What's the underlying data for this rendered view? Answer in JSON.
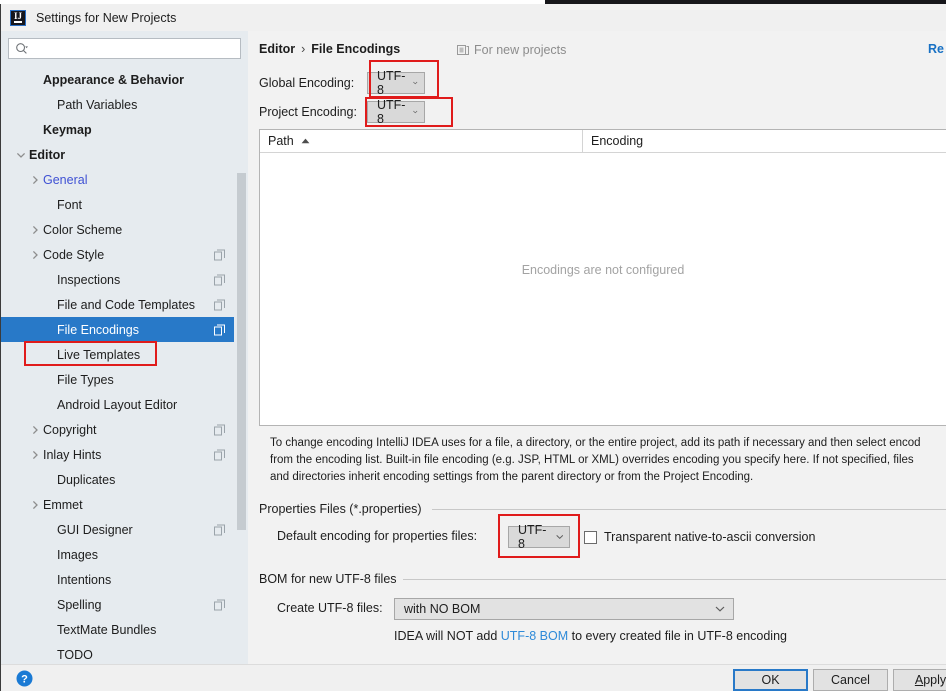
{
  "window": {
    "title": "Settings for New Projects",
    "logo_icon": "intellij-idea-logo"
  },
  "sidebar": {
    "search": {
      "placeholder": "",
      "value": "",
      "icon": "search-icon"
    },
    "items": [
      {
        "label": "Appearance & Behavior",
        "level": 1,
        "category": true,
        "arrow": "none",
        "copy": false,
        "selected": false,
        "link": false
      },
      {
        "label": "Path Variables",
        "level": 2,
        "category": false,
        "arrow": "none",
        "copy": false,
        "selected": false,
        "link": false
      },
      {
        "label": "Keymap",
        "level": 1,
        "category": true,
        "arrow": "none",
        "copy": false,
        "selected": false,
        "link": false
      },
      {
        "label": "Editor",
        "level": 1,
        "category": true,
        "arrow": "down",
        "copy": false,
        "selected": false,
        "link": false
      },
      {
        "label": "General",
        "level": 2,
        "category": false,
        "arrow": "right",
        "copy": false,
        "selected": false,
        "link": true
      },
      {
        "label": "Font",
        "level": 2,
        "category": false,
        "arrow": "none",
        "copy": false,
        "selected": false,
        "link": false
      },
      {
        "label": "Color Scheme",
        "level": 2,
        "category": false,
        "arrow": "right",
        "copy": false,
        "selected": false,
        "link": false
      },
      {
        "label": "Code Style",
        "level": 2,
        "category": false,
        "arrow": "right",
        "copy": true,
        "selected": false,
        "link": false
      },
      {
        "label": "Inspections",
        "level": 2,
        "category": false,
        "arrow": "none",
        "copy": true,
        "selected": false,
        "link": false
      },
      {
        "label": "File and Code Templates",
        "level": 2,
        "category": false,
        "arrow": "none",
        "copy": true,
        "selected": false,
        "link": false
      },
      {
        "label": "File Encodings",
        "level": 2,
        "category": false,
        "arrow": "none",
        "copy": true,
        "selected": true,
        "link": false
      },
      {
        "label": "Live Templates",
        "level": 2,
        "category": false,
        "arrow": "none",
        "copy": false,
        "selected": false,
        "link": false
      },
      {
        "label": "File Types",
        "level": 2,
        "category": false,
        "arrow": "none",
        "copy": false,
        "selected": false,
        "link": false
      },
      {
        "label": "Android Layout Editor",
        "level": 2,
        "category": false,
        "arrow": "none",
        "copy": false,
        "selected": false,
        "link": false
      },
      {
        "label": "Copyright",
        "level": 2,
        "category": false,
        "arrow": "right",
        "copy": true,
        "selected": false,
        "link": false
      },
      {
        "label": "Inlay Hints",
        "level": 2,
        "category": false,
        "arrow": "right",
        "copy": true,
        "selected": false,
        "link": false
      },
      {
        "label": "Duplicates",
        "level": 2,
        "category": false,
        "arrow": "none",
        "copy": false,
        "selected": false,
        "link": false
      },
      {
        "label": "Emmet",
        "level": 2,
        "category": false,
        "arrow": "right",
        "copy": false,
        "selected": false,
        "link": false
      },
      {
        "label": "GUI Designer",
        "level": 2,
        "category": false,
        "arrow": "none",
        "copy": true,
        "selected": false,
        "link": false
      },
      {
        "label": "Images",
        "level": 2,
        "category": false,
        "arrow": "none",
        "copy": false,
        "selected": false,
        "link": false
      },
      {
        "label": "Intentions",
        "level": 2,
        "category": false,
        "arrow": "none",
        "copy": false,
        "selected": false,
        "link": false
      },
      {
        "label": "Spelling",
        "level": 2,
        "category": false,
        "arrow": "none",
        "copy": true,
        "selected": false,
        "link": false
      },
      {
        "label": "TextMate Bundles",
        "level": 2,
        "category": false,
        "arrow": "none",
        "copy": false,
        "selected": false,
        "link": false
      },
      {
        "label": "TODO",
        "level": 2,
        "category": false,
        "arrow": "none",
        "copy": false,
        "selected": false,
        "link": false
      }
    ]
  },
  "main": {
    "breadcrumb": {
      "parent": "Editor",
      "separator": "›",
      "current": "File Encodings"
    },
    "scope_label": "For new projects",
    "scope_icon": "module-icon",
    "reset_link": "Re",
    "global_encoding": {
      "label": "Global Encoding:",
      "value": "UTF-8",
      "highlighted": true
    },
    "project_encoding": {
      "label": "Project Encoding:",
      "value": "UTF-8",
      "highlighted": true
    },
    "table": {
      "columns": [
        "Path",
        "Encoding"
      ],
      "sort_column": "Path",
      "sort_direction": "ascending",
      "rows": [],
      "empty_message": "Encodings are not configured"
    },
    "description_lines": [
      "To change encoding IntelliJ IDEA uses for a file, a directory, or the entire project, add its path if necessary and then select encod",
      "from the encoding list. Built-in file encoding (e.g. JSP, HTML or XML) overrides encoding you specify here. If not specified, files",
      "and directories inherit encoding settings from the parent directory or from the Project Encoding."
    ],
    "properties_group": {
      "title": "Properties Files (*.properties)",
      "default_encoding_label": "Default encoding for properties files:",
      "default_encoding_value": "UTF-8",
      "transparent_checkbox_label": "Transparent native-to-ascii conversion",
      "transparent_checked": false
    },
    "bom_group": {
      "title": "BOM for new UTF-8 files",
      "create_label": "Create UTF-8 files:",
      "create_value": "with NO BOM",
      "note_prefix": "IDEA will NOT add ",
      "note_link": "UTF-8 BOM",
      "note_suffix": " to every created file in UTF-8 encoding"
    }
  },
  "footer": {
    "help_icon": "help-question-icon",
    "ok": "OK",
    "cancel": "Cancel",
    "apply_underlined": "A",
    "apply_rest": "pply"
  },
  "colors": {
    "accent_blue": "#2879c8",
    "selection_blue": "#2879c8",
    "annotation_red": "#e01b1b",
    "link_blue": "#2e8ad8",
    "tree_link": "#3f51d4"
  }
}
